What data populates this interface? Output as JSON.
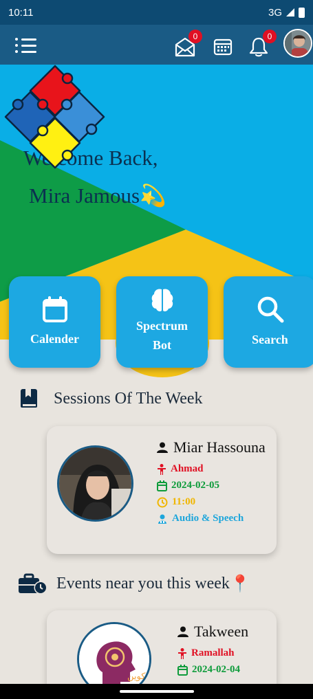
{
  "status_bar": {
    "time": "10:11",
    "network": "3G"
  },
  "app_bar": {
    "icons": [
      "menu-icon",
      "mail-icon",
      "calendar-icon",
      "bell-icon",
      "avatar"
    ],
    "mail_badge": "0",
    "notification_badge": "0"
  },
  "hero": {
    "welcome_line1": "Welcome Back,",
    "welcome_line2": "Mira Jamous",
    "emoji": "💫"
  },
  "quick_actions": [
    {
      "label": "Calender",
      "icon": "calendar-icon"
    },
    {
      "label_line1": "Spectrum",
      "label_line2": "Bot",
      "icon": "brain-icon"
    },
    {
      "label": "Search",
      "icon": "search-icon"
    }
  ],
  "sessions": {
    "title": "Sessions Of The Week",
    "card": {
      "name": "Miar Hassouna",
      "child": "Ahmad",
      "date": "2024-02-05",
      "time": "11:00",
      "type": "Audio & Speech"
    }
  },
  "events": {
    "title": "Events near you this week",
    "pin": "📍",
    "card": {
      "name": "Takween",
      "location": "Ramallah",
      "date": "2024-02-04",
      "logo_text": "تكوين"
    }
  },
  "colors": {
    "app_bar": "#1a5b85",
    "status_bar": "#0d4a72",
    "hero_sky": "#0aaee6",
    "hero_green": "#0e9c47",
    "hero_yellow": "#f5c316",
    "action_tile": "#1da8e2",
    "background": "#e8e4de"
  }
}
